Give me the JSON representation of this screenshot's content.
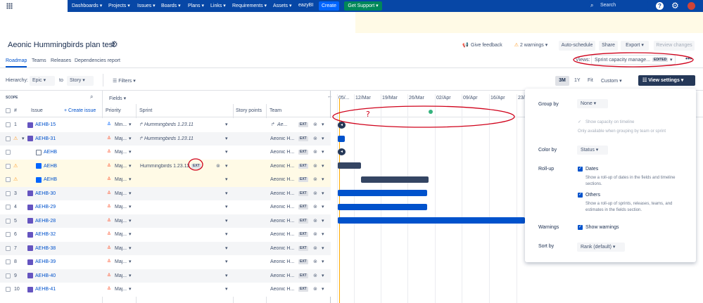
{
  "nav": {
    "items": [
      "Dashboards ▾",
      "Projects ▾",
      "Issues ▾",
      "Boards ▾",
      "Plans ▾",
      "Links ▾",
      "Requirements ▾",
      "Assets ▾",
      "eazyBI"
    ],
    "create": "Create",
    "get_support": "Get Support ▾",
    "search_placeholder": "Search",
    "colors": {
      "nav": "#0747a6",
      "create": "#0065ff",
      "support": "#00875a"
    }
  },
  "plan": {
    "title": "Aeonic Hummingbirds plan test"
  },
  "toolbar": {
    "feedback": "Give feedback",
    "warnings": "2 warnings",
    "auto_schedule": "Auto-schedule",
    "share": "Share",
    "export": "Export",
    "review": "Review changes",
    "views_label": "Views:",
    "view_name": "Sprint capacity manage...",
    "view_badge": "EDITED"
  },
  "tabs": [
    "Roadmap",
    "Teams",
    "Releases",
    "Dependencies report"
  ],
  "filters": {
    "hierarchy_label": "Hierarchy:",
    "from": "Epic",
    "to_label": "to",
    "to": "Story",
    "filters": "Filters"
  },
  "zoom": {
    "options": [
      "3M",
      "1Y",
      "Fit",
      "Custom"
    ],
    "view_settings": "View settings"
  },
  "columns": {
    "scope": "SCOPE",
    "fields": "Fields",
    "num": "#",
    "issue": "Issue",
    "create_issue": "+ Create issue",
    "priority": "Priority",
    "sprint": "Sprint",
    "story_points": "Story points",
    "team": "Team"
  },
  "timeline": {
    "dates": [
      "05/...",
      "12/Mar",
      "19/Mar",
      "26/Mar",
      "02/Apr",
      "09/Apr",
      "16/Apr",
      "23/"
    ]
  },
  "rows": [
    {
      "num": "1",
      "key": "AEHB-15",
      "priority": "Min...",
      "sprint": "Hummingbirds 1.23.11",
      "team": "Ae...",
      "badge": "EXT",
      "type": "epic"
    },
    {
      "num": "2",
      "key": "AEHB-31",
      "priority": "Maj...",
      "sprint": "Hummingbirds 1.23.11",
      "team": "Aeonic H...",
      "badge": "EXT",
      "type": "epic"
    },
    {
      "num": "",
      "key": "AEHB",
      "priority": "Maj...",
      "sprint": "",
      "team": "Aeonic H...",
      "badge": "EXT",
      "type": "sub"
    },
    {
      "num": "",
      "key": "AEHB",
      "priority": "Maj...",
      "sprint": "Hummingbirds 1.23.11",
      "team": "Aeonic H...",
      "badge": "EXT",
      "type": "story"
    },
    {
      "num": "",
      "key": "AEHB",
      "priority": "Maj...",
      "sprint": "",
      "team": "Aeonic H...",
      "badge": "EXT",
      "type": "story"
    },
    {
      "num": "3",
      "key": "AEHB-30",
      "priority": "Maj...",
      "sprint": "",
      "team": "Aeonic H...",
      "badge": "EXT",
      "type": "epic"
    },
    {
      "num": "4",
      "key": "AEHB-29",
      "priority": "Maj...",
      "sprint": "",
      "team": "Aeonic H...",
      "badge": "EXT",
      "type": "epic"
    },
    {
      "num": "5",
      "key": "AEHB-28",
      "priority": "Maj...",
      "sprint": "",
      "team": "Aeonic H...",
      "badge": "EXT",
      "type": "epic"
    },
    {
      "num": "6",
      "key": "AEHB-32",
      "priority": "Maj...",
      "sprint": "",
      "team": "Aeonic H...",
      "badge": "EXT",
      "type": "epic"
    },
    {
      "num": "7",
      "key": "AEHB-38",
      "priority": "Maj...",
      "sprint": "",
      "team": "Aeonic H...",
      "badge": "EXT",
      "type": "epic"
    },
    {
      "num": "8",
      "key": "AEHB-39",
      "priority": "Maj...",
      "sprint": "",
      "team": "Aeonic H...",
      "badge": "EXT",
      "type": "epic"
    },
    {
      "num": "9",
      "key": "AEHB-40",
      "priority": "Maj...",
      "sprint": "",
      "team": "Aeonic H...",
      "badge": "EXT",
      "type": "epic"
    },
    {
      "num": "10",
      "key": "AEHB-41",
      "priority": "Maj...",
      "sprint": "",
      "team": "Aeonic H...",
      "badge": "EXT",
      "type": "epic"
    }
  ],
  "annotation": {
    "mark": "?"
  },
  "settings": {
    "group_by": "Group by",
    "group_val": "None",
    "show_capacity": "Show capacity on timeline",
    "capacity_note": "Only available when grouping by team or sprint",
    "color_by": "Color by",
    "color_val": "Status",
    "rollup": "Roll-up",
    "dates": "Dates",
    "dates_desc1": "Show a roll-up of dates in the fields and timeline",
    "dates_desc2": "sections.",
    "others": "Others",
    "others_desc1": "Show a roll-up of sprints, releases, teams, and",
    "others_desc2": "estimates in the fields section.",
    "warnings": "Warnings",
    "show_warnings": "Show warnings",
    "sort_by": "Sort by",
    "sort_val": "Rank (default)"
  }
}
